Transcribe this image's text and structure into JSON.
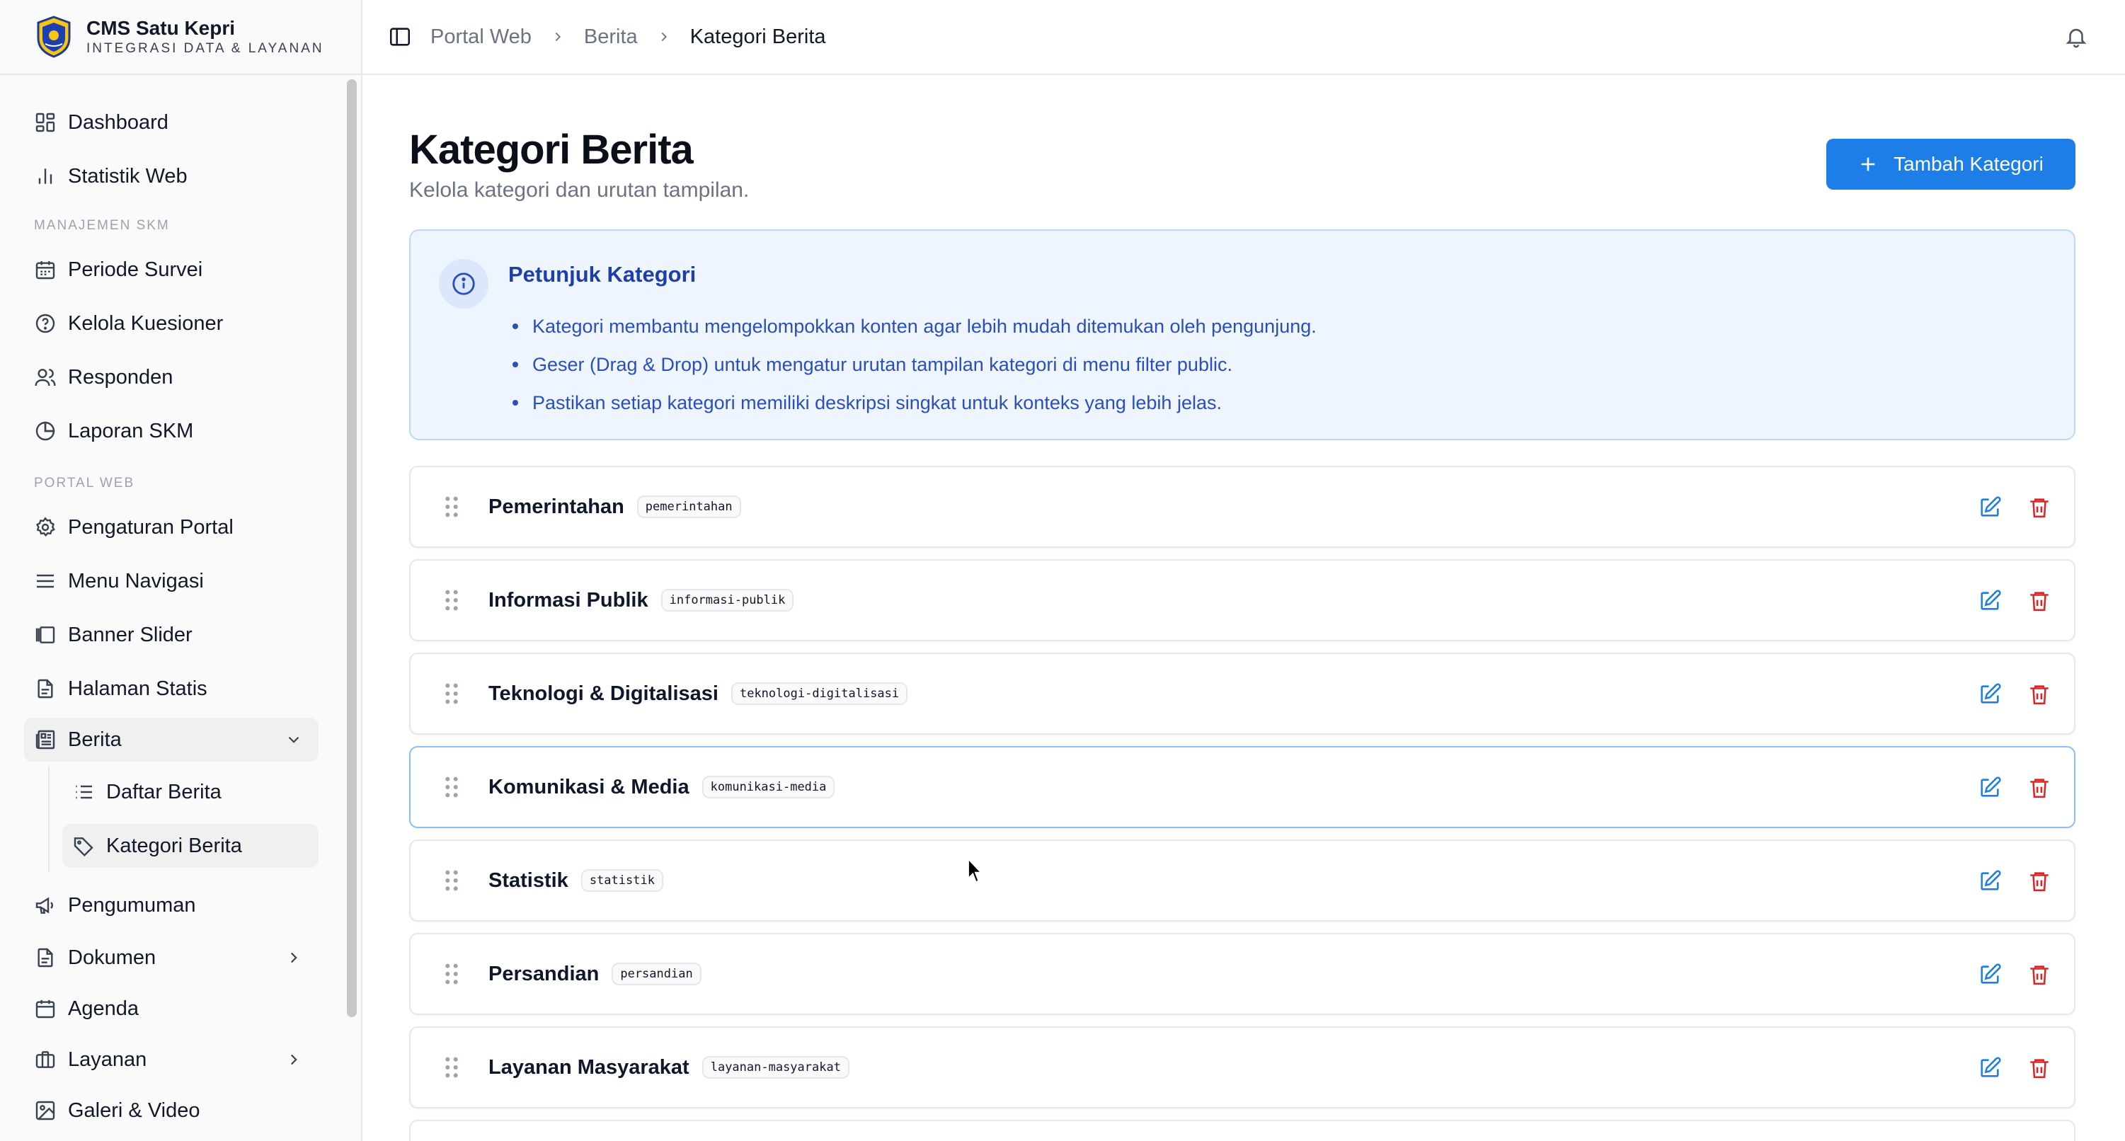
{
  "brand": {
    "title": "CMS Satu Kepri",
    "subtitle": "INTEGRASI DATA & LAYANAN"
  },
  "sidebar": {
    "items_top": [
      {
        "label": "Dashboard",
        "icon": "grid-icon"
      },
      {
        "label": "Statistik Web",
        "icon": "bar-chart-icon"
      }
    ],
    "section_skm": "MANAJEMEN SKM",
    "items_skm": [
      {
        "label": "Periode Survei",
        "icon": "calendar-icon"
      },
      {
        "label": "Kelola Kuesioner",
        "icon": "help-circle-icon"
      },
      {
        "label": "Responden",
        "icon": "users-icon"
      },
      {
        "label": "Laporan SKM",
        "icon": "pie-chart-icon"
      }
    ],
    "section_portal": "PORTAL WEB",
    "items_portal": [
      {
        "label": "Pengaturan Portal",
        "icon": "gear-icon"
      },
      {
        "label": "Menu Navigasi",
        "icon": "menu-icon"
      },
      {
        "label": "Banner Slider",
        "icon": "gallery-icon"
      },
      {
        "label": "Halaman Statis",
        "icon": "file-icon"
      },
      {
        "label": "Berita",
        "icon": "newspaper-icon"
      },
      {
        "label": "Daftar Berita",
        "icon": "list-icon"
      },
      {
        "label": "Kategori Berita",
        "icon": "tag-icon"
      },
      {
        "label": "Pengumuman",
        "icon": "megaphone-icon"
      },
      {
        "label": "Dokumen",
        "icon": "file-icon"
      },
      {
        "label": "Agenda",
        "icon": "calendar-icon"
      },
      {
        "label": "Layanan",
        "icon": "briefcase-icon"
      },
      {
        "label": "Galeri & Video",
        "icon": "image-icon"
      }
    ]
  },
  "breadcrumb": [
    "Portal Web",
    "Berita",
    "Kategori Berita"
  ],
  "page": {
    "title": "Kategori Berita",
    "subtitle": "Kelola kategori dan urutan tampilan.",
    "add_button": "Tambah Kategori"
  },
  "info": {
    "title": "Petunjuk Kategori",
    "points": [
      "Kategori membantu mengelompokkan konten agar lebih mudah ditemukan oleh pengunjung.",
      "Geser (Drag & Drop) untuk mengatur urutan tampilan kategori di menu filter public.",
      "Pastikan setiap kategori memiliki deskripsi singkat untuk konteks yang lebih jelas."
    ]
  },
  "categories": [
    {
      "name": "Pemerintahan",
      "slug": "pemerintahan"
    },
    {
      "name": "Informasi Publik",
      "slug": "informasi-publik"
    },
    {
      "name": "Teknologi & Digitalisasi",
      "slug": "teknologi-digitalisasi"
    },
    {
      "name": "Komunikasi & Media",
      "slug": "komunikasi-media"
    },
    {
      "name": "Statistik",
      "slug": "statistik"
    },
    {
      "name": "Persandian",
      "slug": "persandian"
    },
    {
      "name": "Layanan Masyarakat",
      "slug": "layanan-masyarakat"
    }
  ],
  "colors": {
    "accent": "#1e7ee8",
    "info_bg": "#eef5fe",
    "info_text": "#2a4fb8",
    "edit_icon": "#1e7ee8",
    "delete_icon": "#dc2626"
  }
}
